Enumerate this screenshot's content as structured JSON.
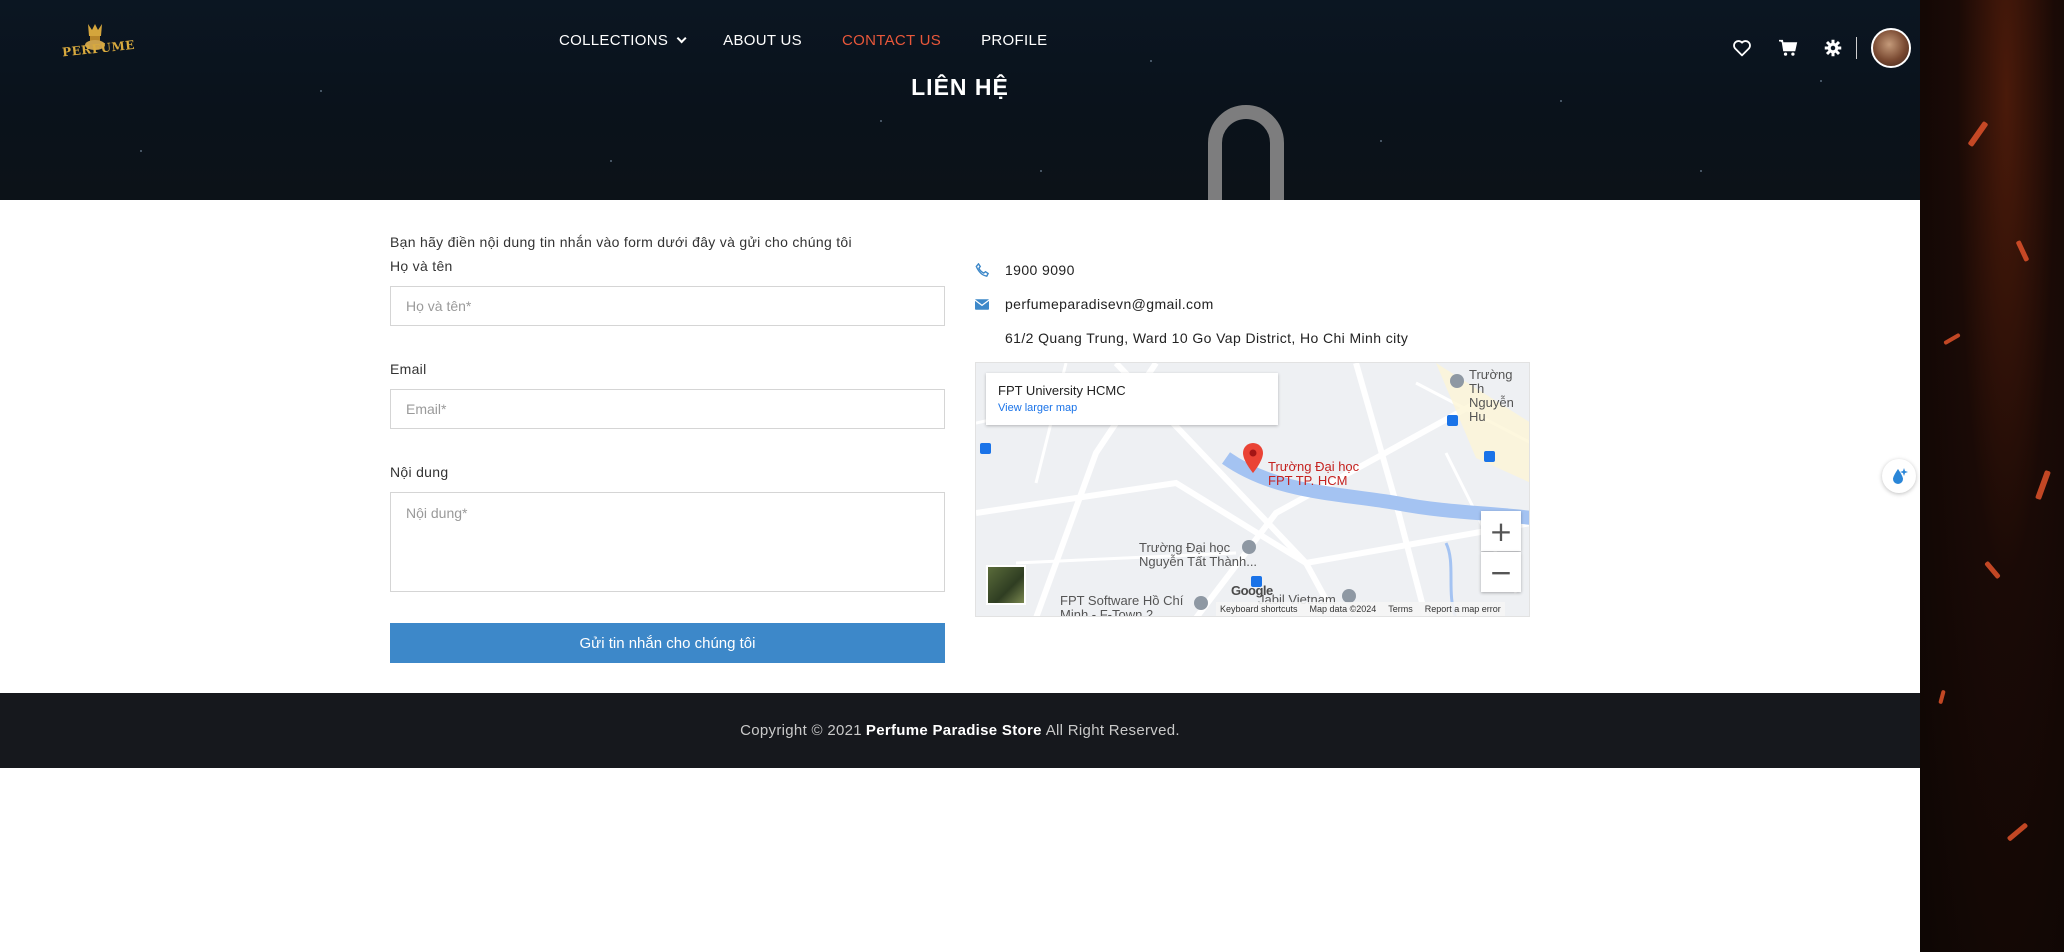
{
  "brand": {
    "logo_text": "PERFUME"
  },
  "nav": {
    "items": [
      {
        "label": "COLLECTIONS",
        "has_dropdown": true,
        "active": false
      },
      {
        "label": "ABOUT US",
        "has_dropdown": false,
        "active": false
      },
      {
        "label": "CONTACT US",
        "has_dropdown": false,
        "active": true
      },
      {
        "label": "PROFILE",
        "has_dropdown": false,
        "active": false
      }
    ]
  },
  "header_icons": [
    "heart-icon",
    "cart-icon",
    "gear-icon"
  ],
  "hero": {
    "title": "LIÊN HỆ"
  },
  "form": {
    "intro": "Bạn hãy điền nội dung tin nhắn vào form dưới đây và gửi cho chúng tôi",
    "name_label": "Họ và tên",
    "name_placeholder": "Họ và tên*",
    "email_label": "Email",
    "email_placeholder": "Email*",
    "content_label": "Nội dung",
    "content_placeholder": "Nội dung*",
    "submit_label": "Gửi tin nhắn cho chúng tôi"
  },
  "contact": {
    "phone": "1900 9090",
    "email": "perfumeparadisevn@gmail.com",
    "address": "61/2 Quang Trung, Ward 10 Go Vap District, Ho Chi Minh city"
  },
  "map": {
    "place_title": "FPT University HCMC",
    "larger_map_link": "View larger map",
    "pin_label_1": "Trường Đại học",
    "pin_label_2": "FPT TP. HCM",
    "poi_1a": "Trường Đại học",
    "poi_1b": "Nguyễn Tất Thành...",
    "poi_2a": "FPT Software Hồ Chí",
    "poi_2b": "Minh - F-Town 2",
    "poi_3": "Jabil Vietnam",
    "poi_4a": "Trường Th",
    "poi_4b": "Nguyễn Hu",
    "zoom_in": "+",
    "zoom_out": "−",
    "attribution": [
      "Keyboard shortcuts",
      "Map data ©2024",
      "Terms",
      "Report a map error"
    ],
    "google": "Google"
  },
  "footer": {
    "prefix": "Copyright © 2021",
    "store": "Perfume Paradise Store",
    "suffix": "All Right Reserved."
  },
  "colors": {
    "accent": "#e8573a",
    "button": "#3d88c9",
    "footer_bg": "#16181d",
    "hero_bg": "#0b1622"
  }
}
